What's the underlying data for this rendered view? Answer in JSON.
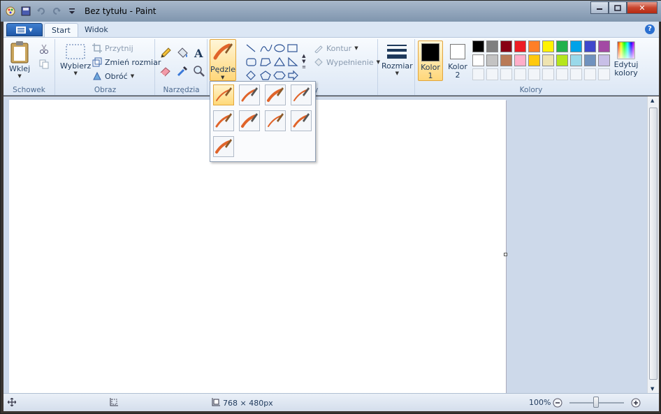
{
  "window": {
    "title": "Bez tytułu - Paint"
  },
  "tabs": [
    {
      "label": "Start"
    },
    {
      "label": "Widok"
    }
  ],
  "help": "?",
  "groups": {
    "schowek": {
      "label": "Schowek",
      "paste": "Wklej"
    },
    "obraz": {
      "label": "Obraz",
      "select": "Wybierz",
      "crop": "Przytnij",
      "resize": "Zmień rozmiar",
      "rotate": "Obróć"
    },
    "narzedzia": {
      "label": "Narzędzia"
    },
    "pedzle": {
      "label": "Pędzle"
    },
    "ksztalty": {
      "label": "Kształty",
      "visible_label_fragment": "ty",
      "outline": "Kontur",
      "fill": "Wypełnienie"
    },
    "rozmiar": {
      "label": "Rozmiar"
    },
    "kolory": {
      "label": "Kolory",
      "color1": "Kolor 1",
      "color2": "Kolor 2",
      "edit": "Edytuj kolory"
    }
  },
  "palette": {
    "row1": [
      "#000000",
      "#7f7f7f",
      "#880015",
      "#ed1c24",
      "#ff7f27",
      "#fff200",
      "#22b14c",
      "#00a2e8",
      "#3f48cc",
      "#a349a4"
    ],
    "row2": [
      "#ffffff",
      "#c3c3c3",
      "#b97a57",
      "#ffaec9",
      "#ffc90e",
      "#efe4b0",
      "#b5e61d",
      "#99d9ea",
      "#7092be",
      "#c8bfe7"
    ]
  },
  "color1_value": "#000000",
  "color2_value": "#ffffff",
  "status": {
    "canvas_size": "768 × 480px",
    "zoom": "100%"
  },
  "brush_menu": {
    "selected_index": 0,
    "count": 9
  }
}
